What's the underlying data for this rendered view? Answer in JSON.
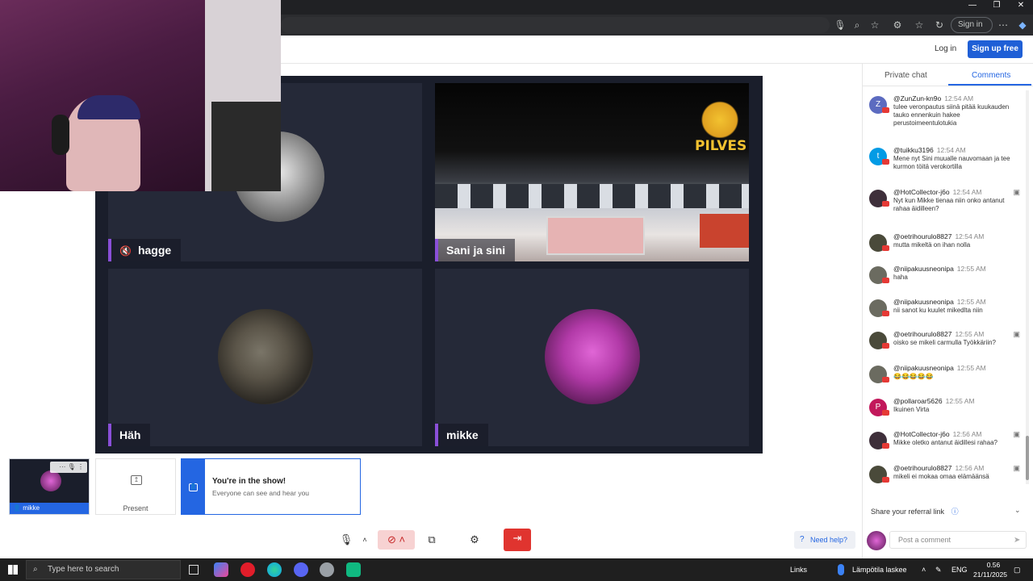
{
  "browser": {
    "signin_label": "Sign in",
    "toolbar_icons": [
      "mic-icon",
      "zoom-icon",
      "star-icon",
      "extensions-icon",
      "favorites-icon",
      "history-icon",
      "menu-icon"
    ]
  },
  "header": {
    "login_label": "Log in",
    "signup_label": "Sign up free"
  },
  "stage": {
    "tiles": [
      {
        "name": "hagge",
        "muted": true
      },
      {
        "name": "Sani ja sini",
        "muted": false
      },
      {
        "name": "Häh",
        "muted": false
      },
      {
        "name": "mikke",
        "muted": false
      }
    ],
    "banner_text": "PILVES"
  },
  "bottom": {
    "self_name": "mikke",
    "present_label": "Present",
    "notice_title": "You're in the show!",
    "notice_body": "Everyone can see and hear you",
    "help_label": "Need help?"
  },
  "side": {
    "tabs": [
      {
        "label": "Private chat",
        "active": false
      },
      {
        "label": "Comments",
        "active": true
      }
    ],
    "comments": [
      {
        "user": "@ZunZun-kn9o",
        "time": "12:54 AM",
        "text": "tulee veronpautus siinä pitää kuukauden tauko ennenkuin hakee perustoimeentulotukia",
        "initial": "Z",
        "color": "#5c6bc0",
        "flag": false
      },
      {
        "user": "@tuikku3196",
        "time": "12:54 AM",
        "text": "Mene nyt Sini muualle nauvomaan ja tee kurmon töitä verokortilla",
        "initial": "t",
        "color": "#039be5",
        "flag": false
      },
      {
        "user": "@HotCollector-j6o",
        "time": "12:54 AM",
        "text": "Nyt kun Mikke tienaa niin onko antanut rahaa äidilleen?",
        "initial": "",
        "color": "#3e2f3a",
        "flag": true
      },
      {
        "user": "@oetrihourulo8827",
        "time": "12:54 AM",
        "text": "mutta mikeltä on ihan nolla",
        "initial": "",
        "color": "#4a4a3a",
        "flag": false
      },
      {
        "user": "@niipakuusneonipa",
        "time": "12:55 AM",
        "text": "haha",
        "initial": "",
        "color": "#6b6b60",
        "flag": false
      },
      {
        "user": "@niipakuusneonipa",
        "time": "12:55 AM",
        "text": "nii sanot ku kuulet mikedlta niin",
        "initial": "",
        "color": "#6b6b60",
        "flag": false
      },
      {
        "user": "@oetrihourulo8827",
        "time": "12:55 AM",
        "text": "oisko se mikeli carmulla Työkkäriin?",
        "initial": "",
        "color": "#4a4a3a",
        "flag": true
      },
      {
        "user": "@niipakuusneonipa",
        "time": "12:55 AM",
        "text": "😂😂😂😂😂",
        "initial": "",
        "color": "#6b6b60",
        "flag": false
      },
      {
        "user": "@pollaroar5626",
        "time": "12:55 AM",
        "text": "Ikuinen Virta",
        "initial": "P",
        "color": "#c2185b",
        "flag": false
      },
      {
        "user": "@HotCollector-j6o",
        "time": "12:56 AM",
        "text": "Mikke oletko antanut äidillesi rahaa?",
        "initial": "",
        "color": "#3e2f3a",
        "flag": true
      },
      {
        "user": "@oetrihourulo8827",
        "time": "12:56 AM",
        "text": "mikeli ei mokaa omaa elämäänsä",
        "initial": "",
        "color": "#4a4a3a",
        "flag": true
      }
    ],
    "referral_label": "Share your referral link",
    "post_placeholder": "Post a comment"
  },
  "taskbar": {
    "search_placeholder": "Type here to search",
    "links_label": "Links",
    "weather_label": "Lämpötila laskee",
    "lang": "ENG",
    "time": "0.56",
    "date": "21/11/2025"
  },
  "colors": {
    "accent": "#2466e2",
    "stage_bg": "#1a1e2b",
    "name_bar": "#8a4fd8",
    "end_button": "#e0342f"
  }
}
